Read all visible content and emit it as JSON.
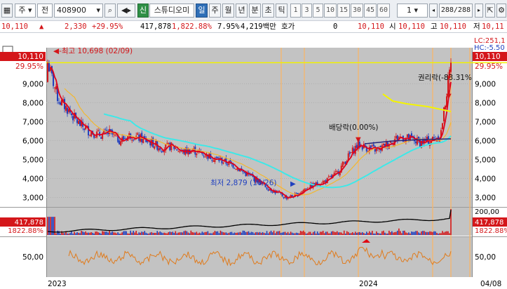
{
  "toolbar": {
    "market_type": "주",
    "period_type": "전",
    "code": "408900",
    "new_badge": "신",
    "stock_name": "스튜디오미",
    "periods": [
      "일",
      "주",
      "월",
      "년",
      "분",
      "초",
      "틱"
    ],
    "active_period": "일",
    "intervals": [
      "1",
      "3",
      "5",
      "10",
      "15",
      "30",
      "45",
      "60"
    ],
    "interval_select": "1",
    "page_count": "288/288"
  },
  "quote": {
    "price": "10,110",
    "change": "2,330",
    "change_pct": "+29.95%",
    "volume": "417,878",
    "volume_pct": "1,822.88%",
    "turnover_pct": "7.95%",
    "amount": "4,219백만",
    "bid_label": "호가",
    "bid_value": "0",
    "bid_price": "10,110",
    "open_label": "시",
    "open": "10,110",
    "high_label": "고",
    "high": "10,110",
    "low_label": "저",
    "low": "10,11"
  },
  "colors": {
    "up": "#d4161a",
    "down": "#1f3fbf",
    "ma_short": "#e0001c",
    "ma_mid": "#f2b830",
    "ma_long": "#3ee8e8",
    "ma_yellow": "#f4f400",
    "ma_navy": "#23237a",
    "event_line": "#f7b66a",
    "ref_line": "#f1f100",
    "rsi": "#e07b1c"
  },
  "price_chart": {
    "last_price_label": "10,110",
    "last_pct_label": "29.95%",
    "high_label": "최고 10,698 (02/09)",
    "low_label": "최저 2,879 (10/26)",
    "dividend_label": "배당락(0.00%)",
    "rights_label": "권리락(-83.31%",
    "lc_label": "LC:251,1",
    "hc_label": "HC:-5.50",
    "y_ticks": [
      "9,000",
      "8,000",
      "7,000",
      "6,000",
      "5,000",
      "4,000",
      "3,000"
    ],
    "y_tick_values": [
      9000,
      8000,
      7000,
      6000,
      5000,
      4000,
      3000
    ],
    "y_range": [
      2500,
      10900
    ]
  },
  "volume_chart": {
    "last_volume": "417,878",
    "last_volume_pct": "1822.88%",
    "tick_label": "200,00"
  },
  "rsi_chart": {
    "tick_label": "50,00"
  },
  "x_axis": {
    "labels": [
      "2023",
      "2024",
      "04/08"
    ]
  },
  "chart_data": {
    "type": "candlestick",
    "x_range": [
      "2023-01",
      "2024-04-08"
    ],
    "y_range": [
      2500,
      10900
    ],
    "series": [
      {
        "name": "price",
        "points": [
          [
            0,
            10110
          ],
          [
            3,
            8200
          ],
          [
            6,
            7600
          ],
          [
            9,
            6900
          ],
          [
            12,
            6500
          ],
          [
            15,
            6300
          ],
          [
            18,
            6400
          ],
          [
            21,
            6000
          ],
          [
            24,
            6300
          ],
          [
            27,
            6100
          ],
          [
            30,
            5900
          ],
          [
            33,
            5600
          ],
          [
            36,
            5700
          ],
          [
            39,
            5400
          ],
          [
            42,
            5500
          ],
          [
            45,
            5300
          ],
          [
            48,
            5100
          ],
          [
            51,
            4900
          ],
          [
            54,
            4700
          ],
          [
            57,
            4300
          ],
          [
            60,
            4000
          ],
          [
            63,
            3600
          ],
          [
            66,
            3300
          ],
          [
            69,
            3000
          ],
          [
            72,
            3100
          ],
          [
            75,
            3500
          ],
          [
            78,
            3700
          ],
          [
            81,
            3900
          ],
          [
            84,
            4300
          ],
          [
            87,
            5100
          ],
          [
            90,
            5800
          ],
          [
            93,
            5600
          ],
          [
            96,
            5500
          ],
          [
            99,
            5900
          ],
          [
            102,
            6200
          ],
          [
            105,
            6100
          ],
          [
            108,
            5900
          ],
          [
            111,
            6000
          ],
          [
            114,
            6300
          ],
          [
            117,
            10110
          ]
        ]
      }
    ],
    "annotations": [
      {
        "label": "최고 10,698 (02/09)",
        "value": 10698
      },
      {
        "label": "최저 2,879 (10/26)",
        "value": 2879
      },
      {
        "label": "배당락(0.00%)"
      },
      {
        "label": "권리락(-83.31%"
      }
    ]
  }
}
